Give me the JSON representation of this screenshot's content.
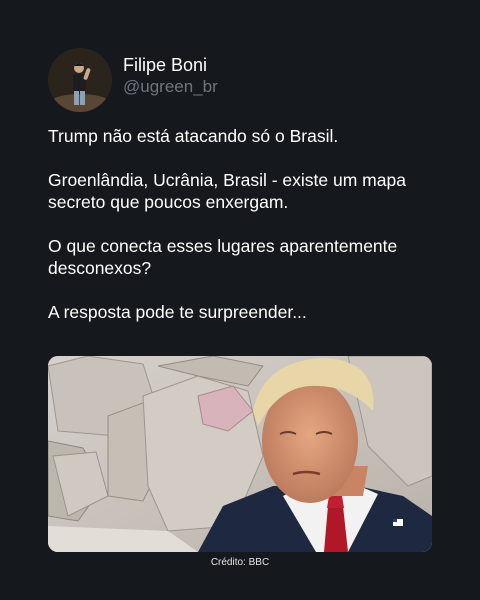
{
  "author": {
    "display_name": "Filipe Boni",
    "handle": "@ugreen_br",
    "avatar_icon": "person-on-stage-avatar"
  },
  "tweet": {
    "paragraphs": [
      "Trump não está atacando só o Brasil.",
      "Groenlândia, Ucrânia, Brasil - existe um mapa secreto que poucos enxergam.",
      "O que conecta esses lugares aparentemente desconexos?",
      "A resposta pode te surpreender..."
    ]
  },
  "media": {
    "description_icon": "trump-in-front-of-rocks-photo",
    "credit": "Crédito: BBC"
  },
  "colors": {
    "background": "#15181c",
    "text": "#ffffff",
    "handle": "#6e767d"
  }
}
